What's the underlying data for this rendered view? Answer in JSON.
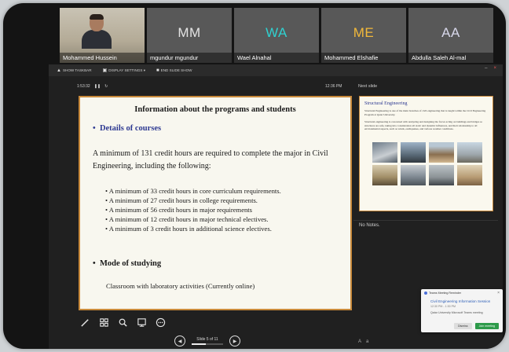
{
  "participants": [
    {
      "name": "Mohammed Hussein",
      "initials": "",
      "has_video": true
    },
    {
      "name": "mgundur mgundur",
      "initials": "MM",
      "color": "#e4e4e4"
    },
    {
      "name": "Wael Alnahal",
      "initials": "WA",
      "color": "#2fd1d0"
    },
    {
      "name": "Mohammed Elshafie",
      "initials": "ME",
      "color": "#f2b93a"
    },
    {
      "name": "Abdulla Saleh Al-mal",
      "initials": "AA",
      "color": "#d7d7ea"
    }
  ],
  "toolbar": {
    "item1": "SHOW TASKBAR",
    "item2": "DISPLAY SETTINGS ▾",
    "item3": "END SLIDE SHOW"
  },
  "window_controls": {
    "minimize": "–",
    "close": "×"
  },
  "timer": "1:53:32",
  "clock": "12:36 PM",
  "next_slide_label": "Next slide",
  "slide": {
    "title": "Information about the programs and students",
    "details_heading": "Details of courses",
    "paragraph": "A minimum of 131 credit hours are required to complete the major in Civil Engineering, including the following:",
    "requirements": [
      "A minimum of 33 credit hours in core curriculum requirements.",
      "A minimum of 27 credit hours in college requirements.",
      "A minimum of 56 credit hours in major requirements",
      "A minimum of 12 credit hours in major technical electives.",
      "A minimum of 3 credit hours in additional science electives."
    ],
    "mode_heading": "Mode of studying",
    "mode_text": "Classroom with laboratory activities (Currently online)"
  },
  "next_slide": {
    "title": "Structural Engineering",
    "p1": "Structural Engineering is one of the main branches of civil engineering that is taught within the Civil Engineering Program at Qatar University.",
    "p2": "Structural engineering is concerned with analyzing and designing the forces acting on buildings and bridges so structures are safe, taking into consideration all static and dynamic influences, and their relationship to all environmental aspects, such as winds, earthquakes, and various weather conditions."
  },
  "notes_label": "No Notes.",
  "navigation": {
    "prev": "◀",
    "next": "▶",
    "counter": "Slide 5 of 11",
    "progress": 0.45
  },
  "toast": {
    "app": "Teams Meeting Reminder",
    "title": "Civil Engineering Information Session",
    "time": "12:30 PM - 1:30 PM",
    "body": "Qatar University Microsoft Teams meeting",
    "dismiss": "Dismiss",
    "start": "Join meeting"
  }
}
